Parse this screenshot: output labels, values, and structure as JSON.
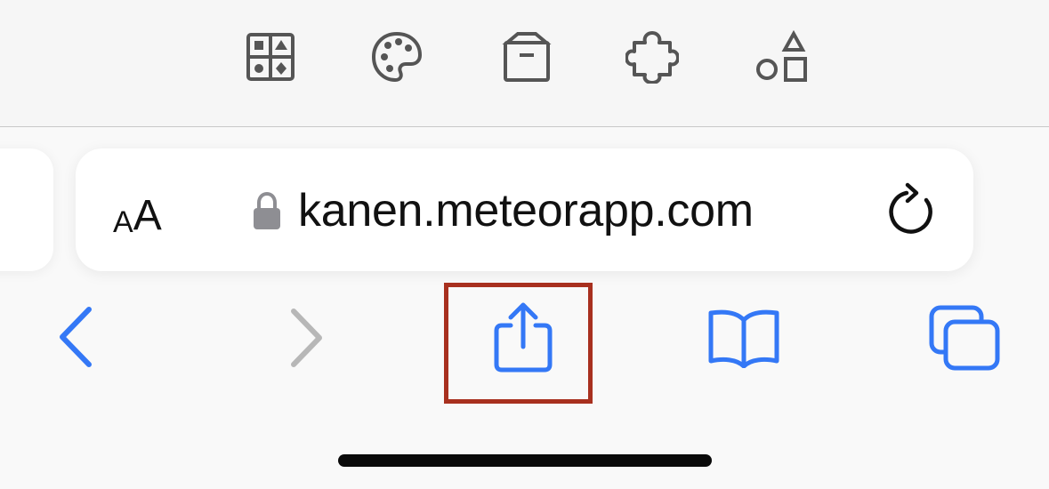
{
  "toolbar": {
    "icons": [
      "collection-grid-icon",
      "palette-icon",
      "archive-box-icon",
      "puzzle-piece-icon",
      "shapes-icon"
    ]
  },
  "address_bar": {
    "text_size_label_small": "A",
    "text_size_label_large": "A",
    "url": "kanen.meteorapp.com",
    "lock_icon": "lock-icon",
    "reload_icon": "reload-icon"
  },
  "nav_bar": {
    "icons": [
      "back-chevron-icon",
      "forward-chevron-icon",
      "share-icon",
      "bookmarks-book-icon",
      "tabs-icon"
    ]
  },
  "colors": {
    "accent": "#3478f6",
    "disabled": "#b7b7b7",
    "icon_dark": "#555555",
    "highlight": "#a8301f",
    "toolbar_bg": "#f6f6f6"
  }
}
